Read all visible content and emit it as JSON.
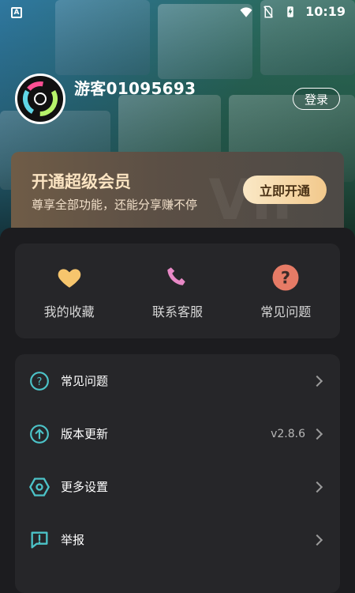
{
  "status_bar": {
    "time": "10:19",
    "left_icon": "A"
  },
  "profile": {
    "username": "游客01095693",
    "login_label": "登录"
  },
  "vip": {
    "title": "开通超级会员",
    "subtitle": "尊享全部功能，还能分享赚不停",
    "button_label": "立即开通"
  },
  "quick_actions": [
    {
      "label": "我的收藏",
      "icon": "heart-icon",
      "color": "#f6c56d"
    },
    {
      "label": "联系客服",
      "icon": "phone-icon",
      "color": "#e889c6"
    },
    {
      "label": "常见问题",
      "icon": "help-icon",
      "color": "#e67b66"
    }
  ],
  "menu": [
    {
      "label": "常见问题",
      "icon": "help-icon",
      "value": ""
    },
    {
      "label": "版本更新",
      "icon": "upload-icon",
      "value": "v2.8.6"
    },
    {
      "label": "更多设置",
      "icon": "settings-icon",
      "value": ""
    },
    {
      "label": "举报",
      "icon": "report-icon",
      "value": ""
    }
  ],
  "colors": {
    "accent_teal": "#4cc3c8",
    "gold": "#f2c98c"
  }
}
